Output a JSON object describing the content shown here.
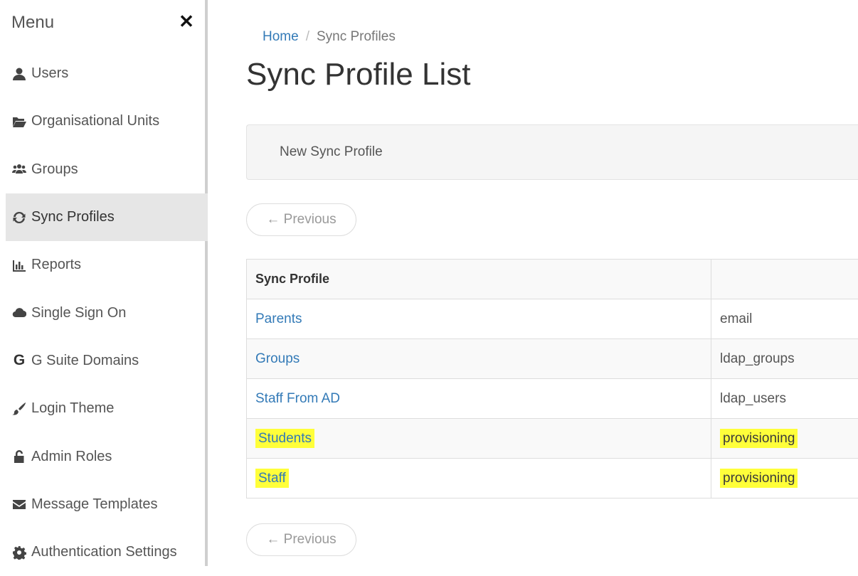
{
  "sidebar": {
    "title": "Menu",
    "close_icon": "✕",
    "items": [
      {
        "label": "Users",
        "icon": "user-icon"
      },
      {
        "label": "Organisational Units",
        "icon": "folder-open-icon"
      },
      {
        "label": "Groups",
        "icon": "users-icon"
      },
      {
        "label": "Sync Profiles",
        "icon": "sync-icon",
        "active": true
      },
      {
        "label": "Reports",
        "icon": "bar-chart-icon"
      },
      {
        "label": "Single Sign On",
        "icon": "cloud-icon"
      },
      {
        "label": "G Suite Domains",
        "icon": "google-icon"
      },
      {
        "label": "Login Theme",
        "icon": "paint-brush-icon"
      },
      {
        "label": "Admin Roles",
        "icon": "unlock-icon"
      },
      {
        "label": "Message Templates",
        "icon": "envelope-icon"
      },
      {
        "label": "Authentication Settings",
        "icon": "cog-icon"
      }
    ]
  },
  "breadcrumb": {
    "home": "Home",
    "separator": "/",
    "current": "Sync Profiles"
  },
  "page_title": "Sync Profile List",
  "toolbar": {
    "new_label": "New Sync Profile"
  },
  "pager": {
    "previous_label": "← Previous"
  },
  "table": {
    "headers": [
      "Sync Profile",
      ""
    ],
    "rows": [
      {
        "name": "Parents",
        "type": "email",
        "highlighted": false
      },
      {
        "name": "Groups",
        "type": "ldap_groups",
        "highlighted": false
      },
      {
        "name": "Staff From AD",
        "type": "ldap_users",
        "highlighted": false
      },
      {
        "name": "Students",
        "type": "provisioning",
        "highlighted": true
      },
      {
        "name": "Staff",
        "type": "provisioning",
        "highlighted": true
      }
    ]
  },
  "colors": {
    "link": "#337ab7",
    "highlight": "#ffff3a",
    "active_nav_bg": "#e6e6e6"
  }
}
